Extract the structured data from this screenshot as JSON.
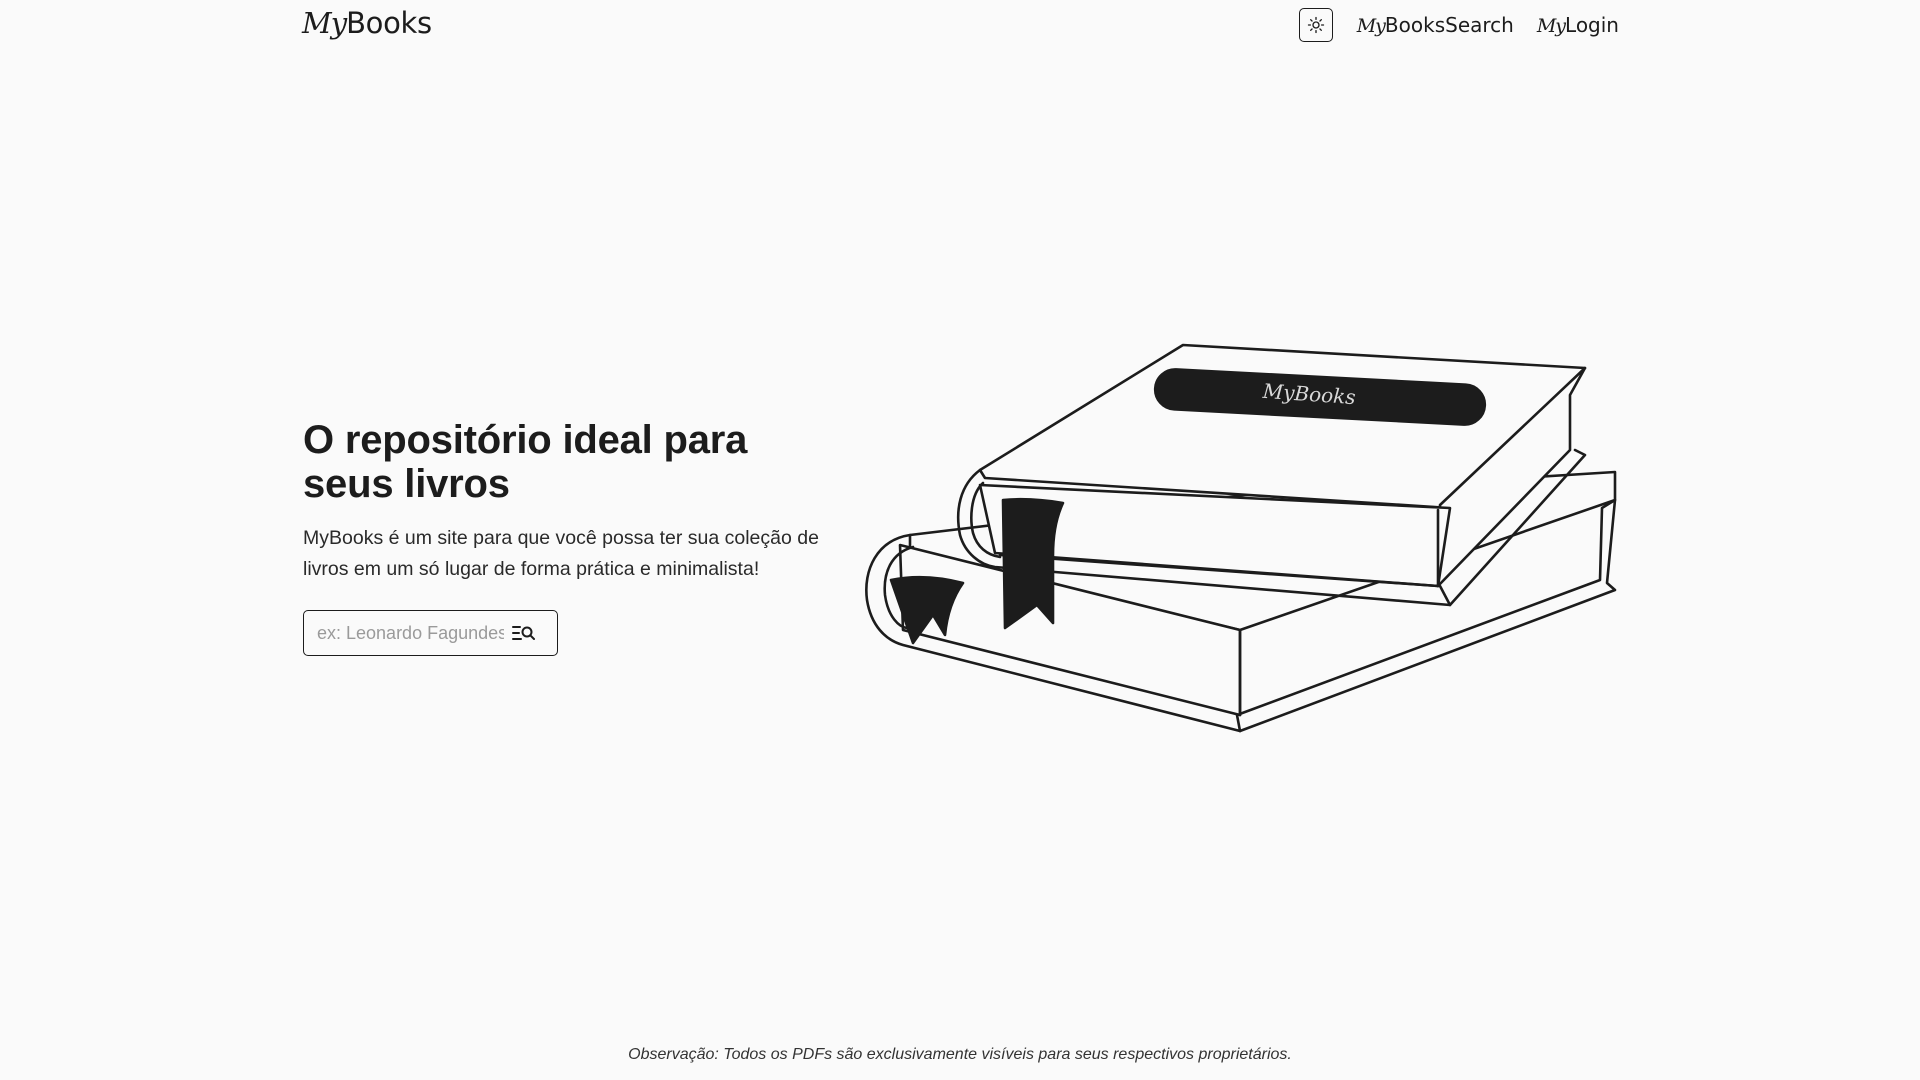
{
  "header": {
    "logo_prefix": "My",
    "logo_suffix": "Books",
    "theme_toggle_icon": "sun-icon",
    "nav": [
      {
        "prefix": "My",
        "label": "BooksSearch"
      },
      {
        "prefix": "My",
        "label": "Login"
      }
    ]
  },
  "hero": {
    "title": "O repositório ideal para seus livros",
    "description": "MyBooks é um site para que você possa ter sua coleção de livros em um só lugar de forma prática e minimalista!",
    "search": {
      "placeholder": "ex: Leonardo Fagundes",
      "value": "",
      "icon": "search-list-icon"
    },
    "illustration": {
      "label": "MyBooks",
      "icon": "books-stack-illustration"
    }
  },
  "footer": {
    "note": "Observação: Todos os PDFs são exclusivamente visíveis para seus respectivos proprietários."
  },
  "colors": {
    "background": "#fafafa",
    "text": "#1c1c1c",
    "muted": "#9a9a9a"
  }
}
